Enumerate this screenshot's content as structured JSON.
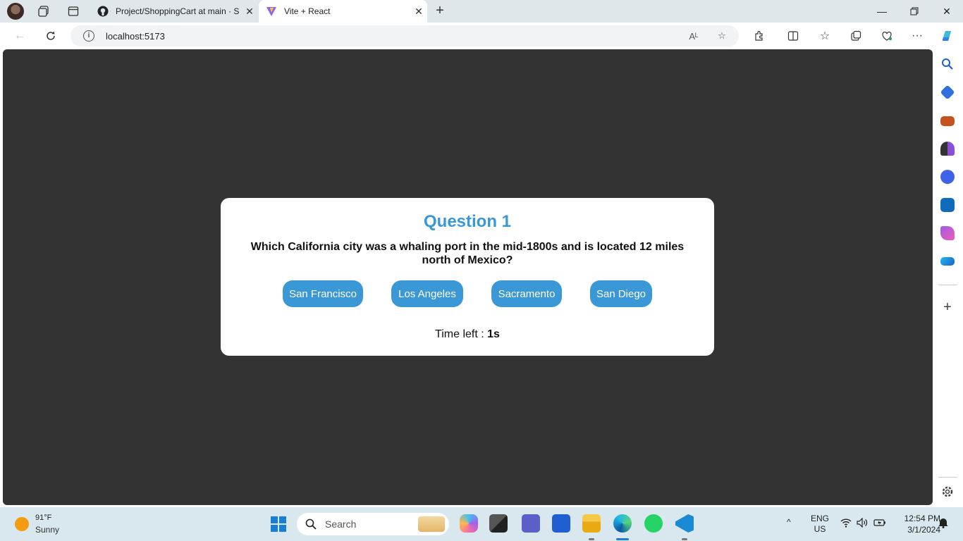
{
  "browser": {
    "tabs": [
      {
        "title": "Project/ShoppingCart at main · S",
        "active": false
      },
      {
        "title": "Vite + React",
        "active": true
      }
    ],
    "url": "localhost:5173"
  },
  "quiz": {
    "title": "Question 1",
    "question": "Which California city was a whaling port in the mid-1800s and is located 12 miles north of Mexico?",
    "options": [
      "San Francisco",
      "Los Angeles",
      "Sacramento",
      "San Diego"
    ],
    "timer_label": "Time left : ",
    "timer_value": "1s"
  },
  "taskbar": {
    "weather_temp": "91°F",
    "weather_condition": "Sunny",
    "search_placeholder": "Search",
    "language": "ENG",
    "region": "US",
    "time": "12:54 PM",
    "date": "3/1/2024"
  },
  "colors": {
    "accent": "#3a98d6",
    "page_background": "#333333",
    "card_background": "#ffffff"
  }
}
